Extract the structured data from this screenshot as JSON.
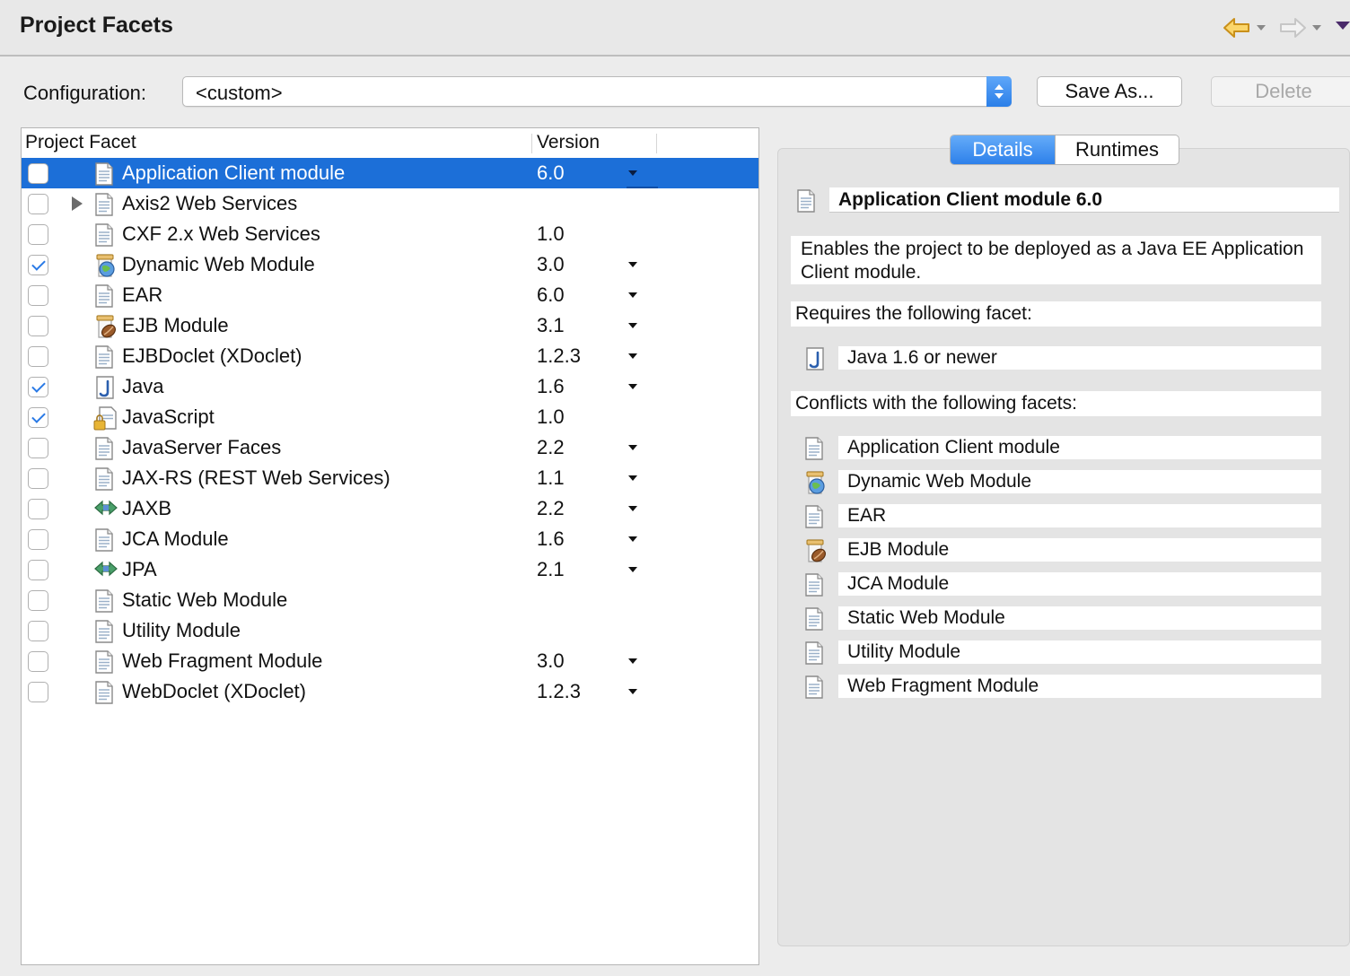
{
  "header": {
    "title": "Project Facets"
  },
  "configuration": {
    "label": "Configuration:",
    "value": "<custom>",
    "save_as": "Save As...",
    "delete": "Delete"
  },
  "table": {
    "col_facet": "Project Facet",
    "col_version": "Version",
    "rows": [
      {
        "name": "Application Client module",
        "version": "6.0",
        "checked": false,
        "icon": "document-icon",
        "dropdown": true,
        "selected": true
      },
      {
        "name": "Axis2 Web Services",
        "version": "",
        "checked": false,
        "icon": "document-icon",
        "dropdown": false,
        "expander": true
      },
      {
        "name": "CXF 2.x Web Services",
        "version": "1.0",
        "checked": false,
        "icon": "document-icon",
        "dropdown": false
      },
      {
        "name": "Dynamic Web Module",
        "version": "3.0",
        "checked": true,
        "icon": "web-module-icon",
        "dropdown": true
      },
      {
        "name": "EAR",
        "version": "6.0",
        "checked": false,
        "icon": "document-icon",
        "dropdown": true
      },
      {
        "name": "EJB Module",
        "version": "3.1",
        "checked": false,
        "icon": "ejb-bean-icon",
        "dropdown": true
      },
      {
        "name": "EJBDoclet (XDoclet)",
        "version": "1.2.3",
        "checked": false,
        "icon": "document-icon",
        "dropdown": true
      },
      {
        "name": "Java",
        "version": "1.6",
        "checked": true,
        "icon": "java-icon",
        "dropdown": true
      },
      {
        "name": "JavaScript",
        "version": "1.0",
        "checked": true,
        "icon": "locked-document-icon",
        "dropdown": false
      },
      {
        "name": "JavaServer Faces",
        "version": "2.2",
        "checked": false,
        "icon": "document-icon",
        "dropdown": true
      },
      {
        "name": "JAX-RS (REST Web Services)",
        "version": "1.1",
        "checked": false,
        "icon": "document-icon",
        "dropdown": true
      },
      {
        "name": "JAXB",
        "version": "2.2",
        "checked": false,
        "icon": "bidirectional-arrow-icon",
        "dropdown": true
      },
      {
        "name": "JCA Module",
        "version": "1.6",
        "checked": false,
        "icon": "document-icon",
        "dropdown": true
      },
      {
        "name": "JPA",
        "version": "2.1",
        "checked": false,
        "icon": "bidirectional-arrow-icon",
        "dropdown": true
      },
      {
        "name": "Static Web Module",
        "version": "",
        "checked": false,
        "icon": "document-icon",
        "dropdown": false
      },
      {
        "name": "Utility Module",
        "version": "",
        "checked": false,
        "icon": "document-icon",
        "dropdown": false
      },
      {
        "name": "Web Fragment Module",
        "version": "3.0",
        "checked": false,
        "icon": "document-icon",
        "dropdown": true
      },
      {
        "name": "WebDoclet (XDoclet)",
        "version": "1.2.3",
        "checked": false,
        "icon": "document-icon",
        "dropdown": true
      }
    ]
  },
  "details": {
    "tabs": {
      "details": "Details",
      "runtimes": "Runtimes"
    },
    "title": "Application Client module 6.0",
    "description": "Enables the project to be deployed as a Java EE Application Client module.",
    "requires_label": "Requires the following facet:",
    "requires": [
      {
        "name": "Java 1.6 or newer",
        "icon": "java-icon"
      }
    ],
    "conflicts_label": "Conflicts with the following facets:",
    "conflicts": [
      {
        "name": "Application Client module",
        "icon": "document-icon"
      },
      {
        "name": "Dynamic Web Module",
        "icon": "web-module-icon"
      },
      {
        "name": "EAR",
        "icon": "document-icon"
      },
      {
        "name": "EJB Module",
        "icon": "ejb-bean-icon"
      },
      {
        "name": "JCA Module",
        "icon": "document-icon"
      },
      {
        "name": "Static Web Module",
        "icon": "document-icon"
      },
      {
        "name": "Utility Module",
        "icon": "document-icon"
      },
      {
        "name": "Web Fragment Module",
        "icon": "document-icon"
      }
    ]
  },
  "colors": {
    "selection": "#1c6fd8",
    "accent": "#2b7fe8",
    "check": "#2a7ae6"
  }
}
